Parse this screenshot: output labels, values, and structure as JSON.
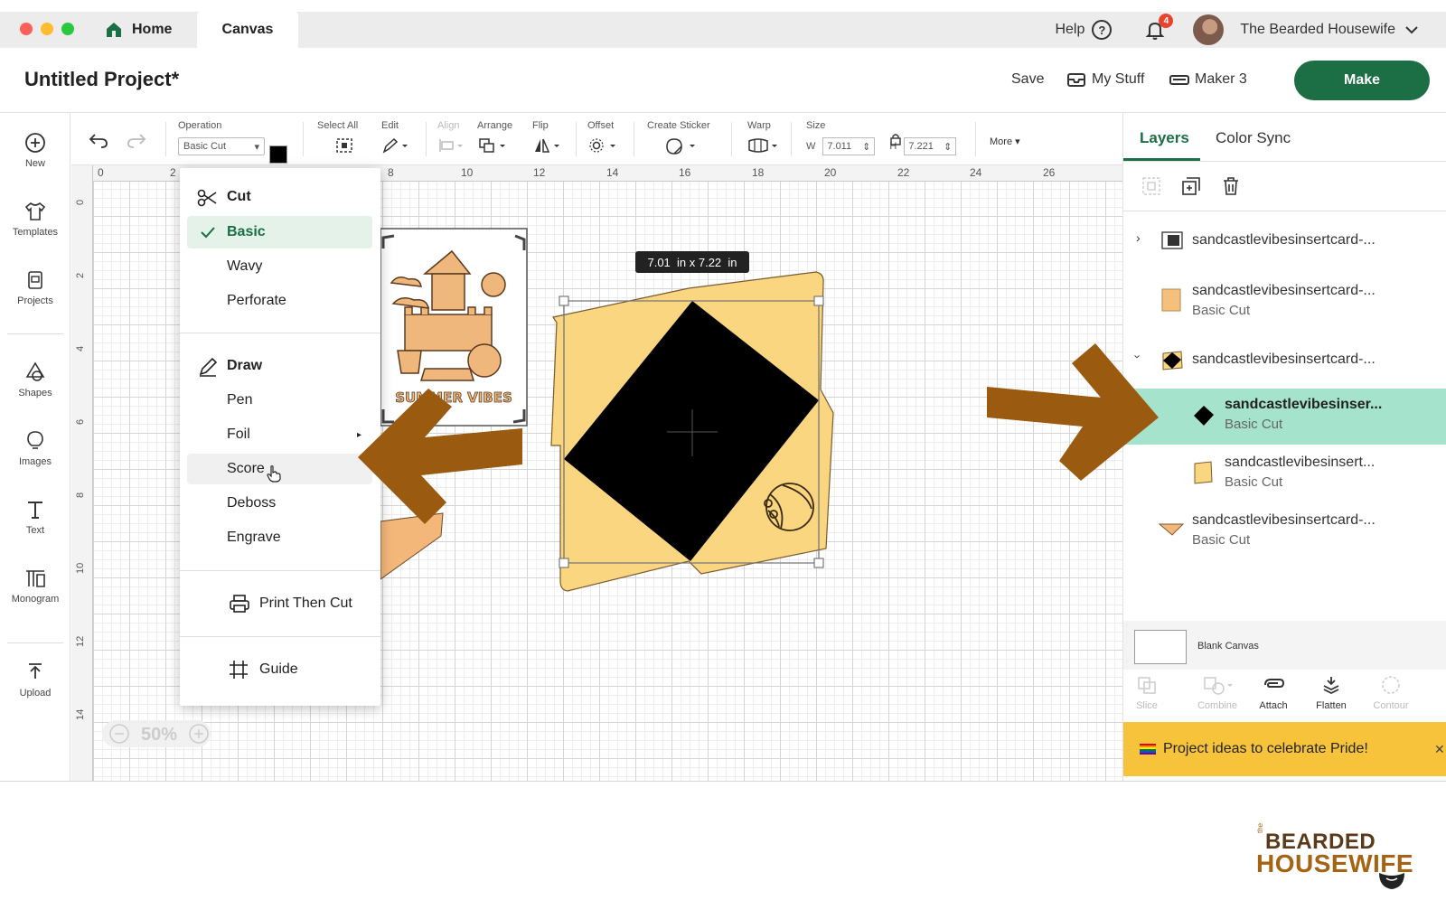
{
  "window": {
    "tabs": [
      {
        "label": "Home"
      },
      {
        "label": "Canvas"
      }
    ],
    "help_label": "Help",
    "notification_count": "4",
    "user_name": "The Bearded Housewife"
  },
  "header": {
    "project_title": "Untitled Project*",
    "save_label": "Save",
    "my_stuff_label": "My Stuff",
    "machine_label": "Maker 3",
    "make_label": "Make"
  },
  "leftbar": {
    "items": [
      {
        "label": "New"
      },
      {
        "label": "Templates"
      },
      {
        "label": "Projects"
      },
      {
        "label": "Shapes"
      },
      {
        "label": "Images"
      },
      {
        "label": "Text"
      },
      {
        "label": "Monogram"
      },
      {
        "label": "Upload"
      }
    ]
  },
  "toolbar": {
    "operation_label": "Operation",
    "operation_value": "Basic Cut",
    "select_all_label": "Select All",
    "edit_label": "Edit",
    "align_label": "Align",
    "arrange_label": "Arrange",
    "flip_label": "Flip",
    "offset_label": "Offset",
    "create_sticker_label": "Create Sticker",
    "warp_label": "Warp",
    "size_label": "Size",
    "w_label": "W",
    "w_value": "7.011",
    "h_label": "H",
    "h_value": "7.221",
    "more_label": "More"
  },
  "ruler": {
    "top_ticks": [
      "0",
      "2",
      "8",
      "10",
      "12",
      "14",
      "16",
      "18",
      "20",
      "22",
      "24",
      "26"
    ],
    "left_ticks": [
      "0",
      "2",
      "4",
      "6",
      "8",
      "10",
      "12",
      "14"
    ]
  },
  "canvas": {
    "size_tooltip": "7.01  in x 7.22  in",
    "card_text": "SUMMER VIBES",
    "zoom_label": "50%"
  },
  "operation_menu": {
    "cut_header": "Cut",
    "cut_items": [
      {
        "label": "Basic"
      },
      {
        "label": "Wavy"
      },
      {
        "label": "Perforate"
      }
    ],
    "draw_header": "Draw",
    "draw_items": [
      {
        "label": "Pen"
      },
      {
        "label": "Foil"
      },
      {
        "label": "Score"
      },
      {
        "label": "Deboss"
      },
      {
        "label": "Engrave"
      }
    ],
    "print_then_cut": "Print Then Cut",
    "guide": "Guide"
  },
  "layers_panel": {
    "tabs": [
      {
        "label": "Layers"
      },
      {
        "label": "Color Sync"
      }
    ],
    "layers": [
      {
        "name": "sandcastlevibesinsertcard-...",
        "sub": ""
      },
      {
        "name": "sandcastlevibesinsertcard-...",
        "sub": "Basic Cut"
      },
      {
        "name": "sandcastlevibesinsertcard-...",
        "sub": ""
      },
      {
        "name": "sandcastlevibesinser...",
        "sub": "Basic Cut"
      },
      {
        "name": "sandcastlevibesinsert...",
        "sub": "Basic Cut"
      },
      {
        "name": "sandcastlevibesinsertcard-...",
        "sub": "Basic Cut"
      }
    ],
    "blank_canvas_label": "Blank Canvas",
    "bottom_actions": [
      {
        "label": "Slice"
      },
      {
        "label": "Combine"
      },
      {
        "label": "Attach"
      },
      {
        "label": "Flatten"
      },
      {
        "label": "Contour"
      }
    ],
    "pride_banner": "Project ideas to celebrate Pride!"
  },
  "brand": {
    "line1": "BEARDED",
    "line2": "HOUSEWIFE",
    "prefix": "the"
  },
  "colors": {
    "accent_green": "#1c6e44",
    "selected_layer": "#a6e3cc",
    "card_yellow": "#f9d67f",
    "arrow_brown": "#9a5a10",
    "banner_yellow": "#f7c33a"
  }
}
